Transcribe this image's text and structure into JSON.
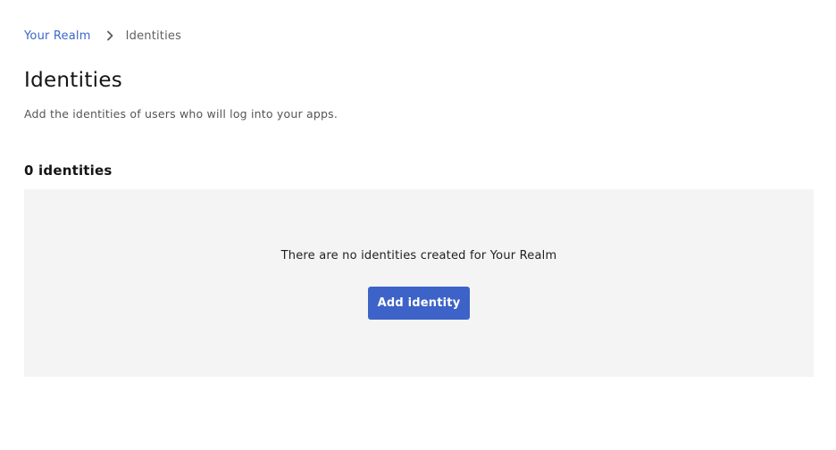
{
  "breadcrumb": {
    "parent_label": "Your Realm",
    "current_label": "Identities",
    "separator_icon": "chevron-right-icon"
  },
  "header": {
    "title": "Identities",
    "subtitle": "Add the identities of users who will log into your apps."
  },
  "identities": {
    "count_label": "0 identities",
    "empty_message": "There are no identities created for Your Realm",
    "add_button_label": "Add identity"
  },
  "colors": {
    "link": "#3b66c9",
    "primary_button": "#3d63c8",
    "empty_panel_bg": "#f4f4f4"
  }
}
